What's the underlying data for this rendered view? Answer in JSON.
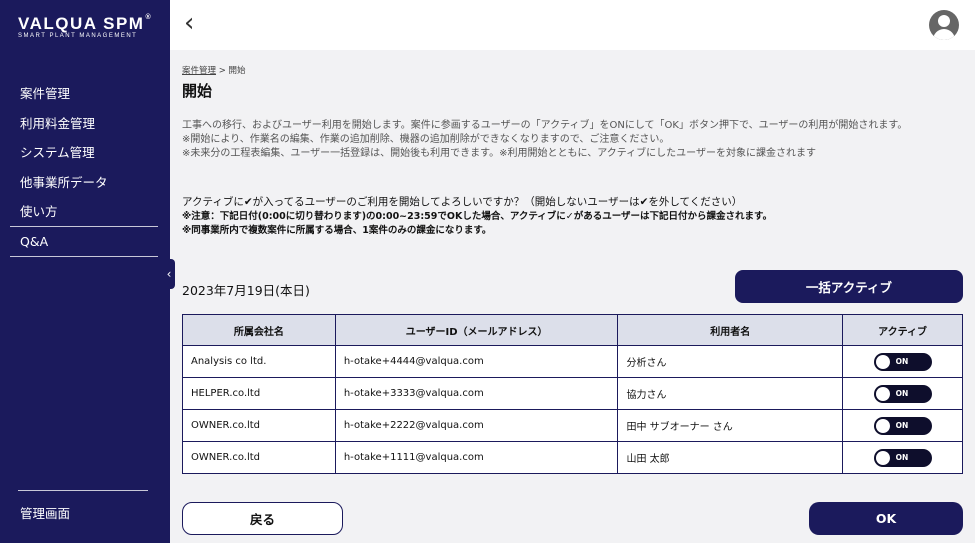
{
  "sidebar": {
    "logo_main": "VALQUA SPM",
    "logo_mark": "®",
    "logo_sub": "SMART PLANT MANAGEMENT",
    "items": [
      {
        "label": "案件管理"
      },
      {
        "label": "利用料金管理"
      },
      {
        "label": "システム管理"
      },
      {
        "label": "他事業所データ"
      },
      {
        "label": "使い方"
      },
      {
        "label": "Q&A"
      }
    ],
    "admin_label": "管理画面",
    "collapse_icon": "‹"
  },
  "header": {
    "back_icon": "‹",
    "avatar_icon": "user-avatar-icon"
  },
  "breadcrumb": {
    "parent": "案件管理",
    "separator": " > ",
    "current": "開始"
  },
  "page": {
    "title": "開始",
    "desc_lines": [
      "工事への移行、およびユーザー利用を開始します。案件に参画するユーザーの「アクティブ」をONにして「OK」ボタン押下で、ユーザーの利用が開始されます。",
      "※開始により、作業名の編集、作業の追加削除、機器の追加削除ができなくなりますので、ご注意ください。",
      "※未来分の工程表編集、ユーザー一括登録は、開始後も利用できます。※利用開始とともに、アクティブにしたユーザーを対象に課金されます"
    ],
    "notice_lines": [
      "アクティブに✔が入ってるユーザーのご利用を開始してよろしいですか？（開始しないユーザーは✔を外してください）",
      "※注意：下記日付(0:00に切り替わります)の0:00~23:59でOKした場合、アクティブに✓があるユーザーは下記日付から課金されます。",
      "※同事業所内で複数案件に所属する場合、1案件のみの課金になります。"
    ],
    "date": "2023年7月19日(本日)",
    "bulk_active_label": "一括アクティブ"
  },
  "table": {
    "headers": [
      "所属会社名",
      "ユーザーID（メールアドレス）",
      "利用者名",
      "アクティブ"
    ],
    "rows": [
      {
        "company": "Analysis co ltd.",
        "email": "h-otake+4444@valqua.com",
        "name": "分析さん",
        "active": "ON"
      },
      {
        "company": "HELPER.co.ltd",
        "email": "h-otake+3333@valqua.com",
        "name": "協力さん",
        "active": "ON"
      },
      {
        "company": "OWNER.co.ltd",
        "email": "h-otake+2222@valqua.com",
        "name": "田中 サブオーナー さん",
        "active": "ON"
      },
      {
        "company": "OWNER.co.ltd",
        "email": "h-otake+1111@valqua.com",
        "name": "山田 太郎",
        "active": "ON"
      }
    ]
  },
  "footer": {
    "back_label": "戻る",
    "ok_label": "OK"
  },
  "colors": {
    "brand": "#1b1a5c",
    "header_bg": "#ffffff",
    "page_bg": "#f2f2f4",
    "table_header_bg": "#dcdfea"
  }
}
